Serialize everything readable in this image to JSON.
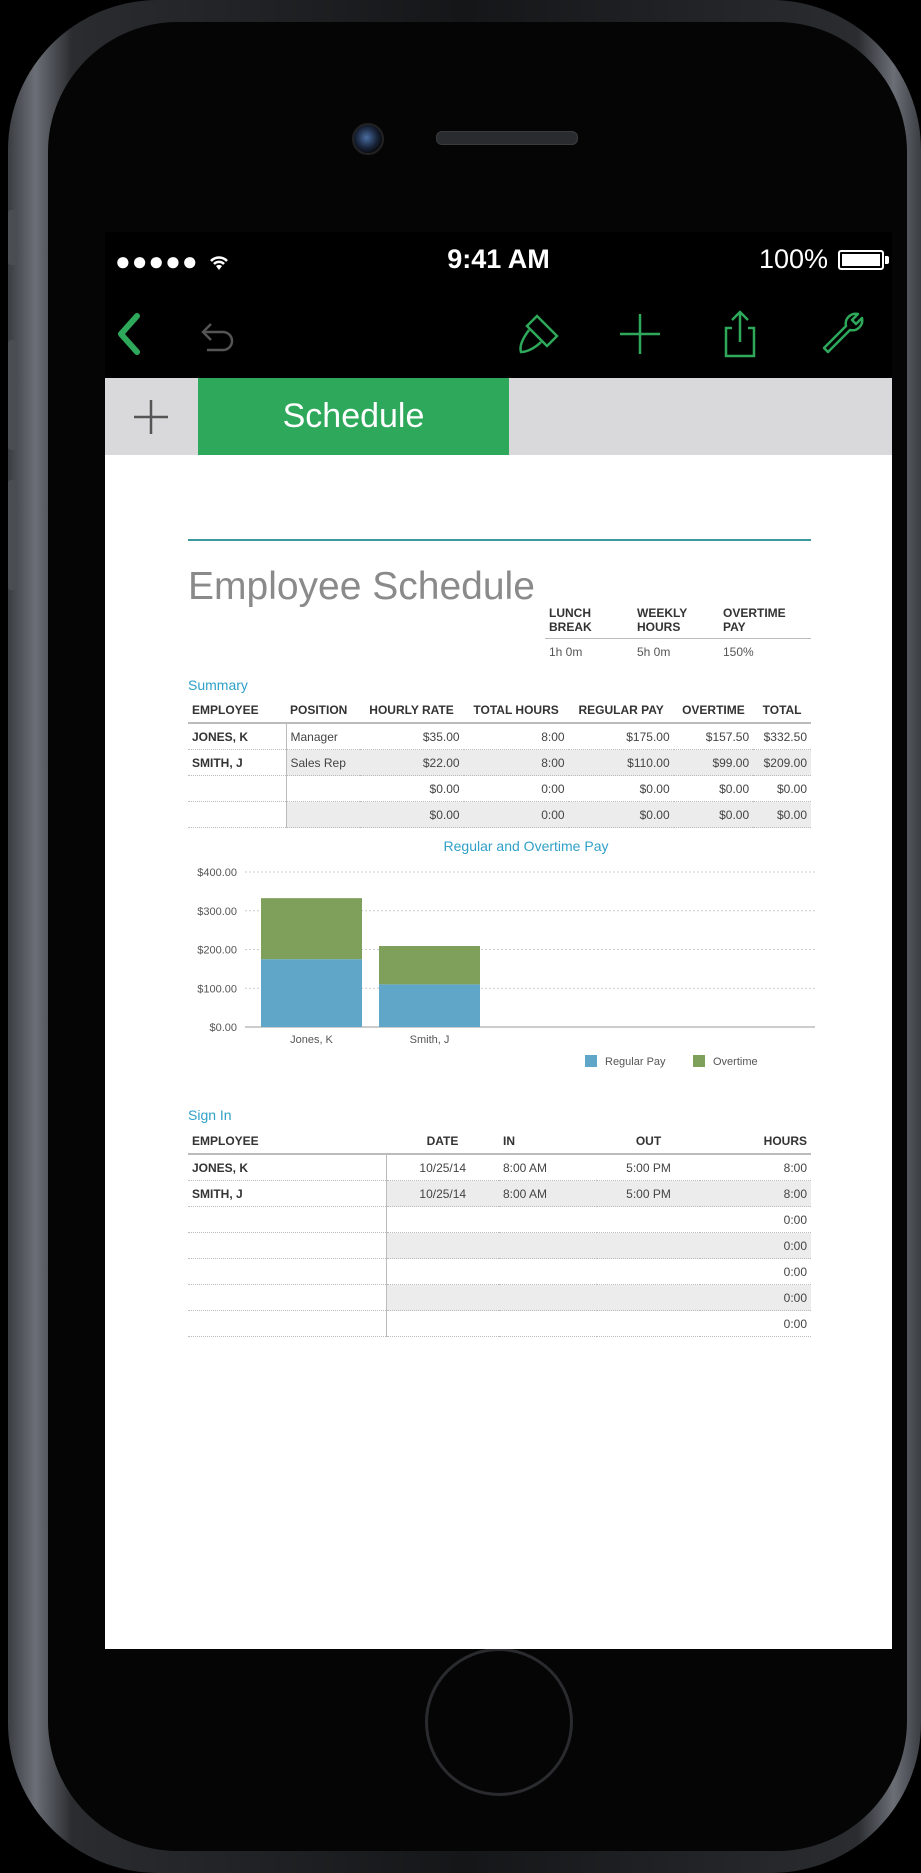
{
  "status": {
    "signal": "●●●●● ",
    "time": "9:41 AM",
    "battery": "100%"
  },
  "toolbar": {
    "icons": [
      "back-chevron-icon",
      "undo-icon",
      "paintbrush-icon",
      "plus-icon",
      "share-icon",
      "wrench-icon"
    ]
  },
  "tabs": {
    "active_label": "Schedule"
  },
  "document": {
    "title": "Employee Schedule",
    "params": {
      "headers": [
        "LUNCH BREAK",
        "WEEKLY HOURS",
        "OVERTIME PAY"
      ],
      "values": [
        "1h 0m",
        "5h 0m",
        "150%"
      ]
    },
    "summary": {
      "label": "Summary",
      "headers": [
        "EMPLOYEE",
        "POSITION",
        "HOURLY RATE",
        "TOTAL HOURS",
        "REGULAR PAY",
        "OVERTIME",
        "TOTAL"
      ],
      "rows": [
        [
          "JONES, K",
          "Manager",
          "$35.00",
          "8:00",
          "$175.00",
          "$157.50",
          "$332.50"
        ],
        [
          "SMITH, J",
          "Sales Rep",
          "$22.00",
          "8:00",
          "$110.00",
          "$99.00",
          "$209.00"
        ],
        [
          "",
          "",
          "$0.00",
          "0:00",
          "$0.00",
          "$0.00",
          "$0.00"
        ],
        [
          "",
          "",
          "$0.00",
          "0:00",
          "$0.00",
          "$0.00",
          "$0.00"
        ]
      ]
    },
    "signin": {
      "label": "Sign In",
      "headers": [
        "EMPLOYEE",
        "DATE",
        "IN",
        "OUT",
        "HOURS"
      ],
      "rows": [
        [
          "JONES, K",
          "10/25/14",
          "8:00 AM",
          "5:00 PM",
          "8:00"
        ],
        [
          "SMITH, J",
          "10/25/14",
          "8:00 AM",
          "5:00 PM",
          "8:00"
        ],
        [
          "",
          "",
          "",
          "",
          "0:00"
        ],
        [
          "",
          "",
          "",
          "",
          "0:00"
        ],
        [
          "",
          "",
          "",
          "",
          "0:00"
        ],
        [
          "",
          "",
          "",
          "",
          "0:00"
        ],
        [
          "",
          "",
          "",
          "",
          "0:00"
        ]
      ]
    }
  },
  "chart_data": {
    "type": "bar",
    "stacked": true,
    "title": "Regular and Overtime Pay",
    "categories": [
      "Jones, K",
      "Smith, J"
    ],
    "series": [
      {
        "name": "Regular Pay",
        "values": [
          175,
          110
        ],
        "color": "#5fa6c8"
      },
      {
        "name": "Overtime",
        "values": [
          157.5,
          99
        ],
        "color": "#7ea05a"
      }
    ],
    "ylim": [
      0,
      400
    ],
    "yticks": [
      "$0.00",
      "$100.00",
      "$200.00",
      "$300.00",
      "$400.00"
    ],
    "grid": true,
    "legend": "bottom-right"
  },
  "colors": {
    "accent": "#2ea85a",
    "section": "#2fa0c8",
    "rule": "#3a9a9e"
  }
}
